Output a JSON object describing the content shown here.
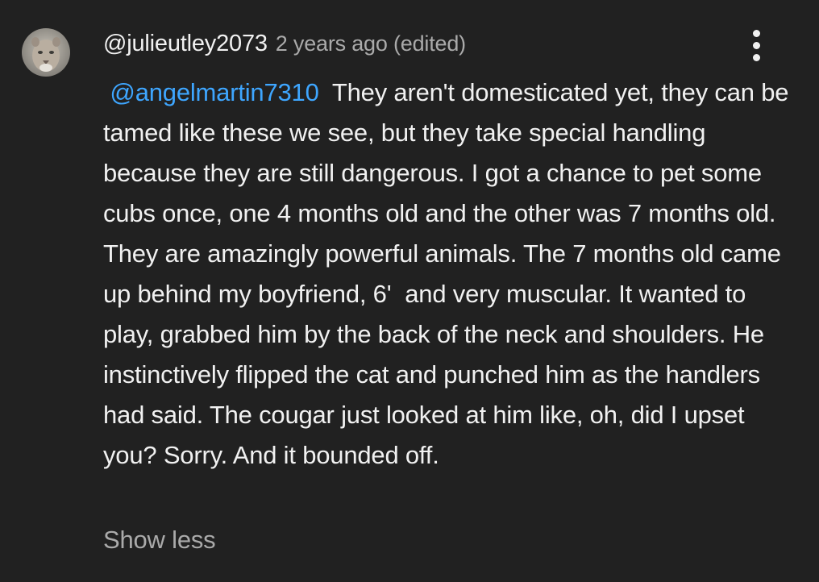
{
  "comment": {
    "author": "@julieutley2073",
    "timestamp": "2 years ago (edited)",
    "avatar_icon": "cougar-avatar",
    "menu_icon": "more-vert-icon",
    "mention": "@angelmartin7310",
    "text": "They aren't domesticated yet, they can be tamed like these we see, but they take special handling because they are still dangerous. I got a chance to pet some cubs once, one 4 months old and the other was 7 months old. They are amazingly powerful animals. The 7 months old came up behind my boyfriend, 6'  and very muscular. It wanted to play, grabbed him by the back of the neck and shoulders. He instinctively flipped the cat and punched him as the handlers had said. The cougar just looked at him like, oh, did I upset you? Sorry. And it bounded off.",
    "show_less_label": "Show less"
  },
  "colors": {
    "background": "#212121",
    "text_primary": "#f1f1f1",
    "text_secondary": "#aaaaaa",
    "mention": "#3ea6ff"
  }
}
